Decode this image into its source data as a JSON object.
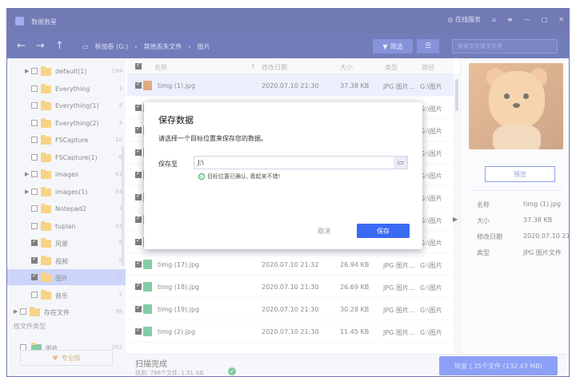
{
  "app": {
    "title": "数据救星"
  },
  "titlebar": {
    "online_service": "在线服务"
  },
  "breadcrumbs": [
    "新加卷 (G:)",
    "其他丢失文件",
    "图片"
  ],
  "toolbar": {
    "filter_label": "筛选",
    "search_placeholder": "搜索文件或文件夹"
  },
  "sidebar": {
    "items": [
      {
        "label": "default(1)",
        "count": "194",
        "checked": false,
        "arrow": true
      },
      {
        "label": "Everything",
        "count": "3",
        "checked": false,
        "arrow": false
      },
      {
        "label": "Everything(1)",
        "count": "4",
        "checked": false,
        "arrow": false
      },
      {
        "label": "Everything(2)",
        "count": "4",
        "checked": false,
        "arrow": false
      },
      {
        "label": "FSCapture",
        "count": "10",
        "checked": false,
        "arrow": false
      },
      {
        "label": "FSCapture(1)",
        "count": "6",
        "checked": false,
        "arrow": false
      },
      {
        "label": "images",
        "count": "63",
        "checked": false,
        "arrow": true
      },
      {
        "label": "images(1)",
        "count": "64",
        "checked": false,
        "arrow": true
      },
      {
        "label": "Notepad2",
        "count": "2",
        "checked": false,
        "arrow": false
      },
      {
        "label": "tuplan",
        "count": "43",
        "checked": false,
        "arrow": false
      },
      {
        "label": "风景",
        "count": "8",
        "checked": true,
        "arrow": false
      },
      {
        "label": "视频",
        "count": "5",
        "checked": true,
        "arrow": false
      },
      {
        "label": "图片",
        "count": "22",
        "checked": true,
        "arrow": false,
        "selected": true
      },
      {
        "label": "音乐",
        "count": "2",
        "checked": false,
        "arrow": false
      },
      {
        "label": "存在文件",
        "count": "98",
        "checked": false,
        "arrow": true
      }
    ],
    "section_title": "按文件类型",
    "type_item": {
      "label": "图片",
      "count": "262"
    },
    "pro_label": "专业版"
  },
  "table": {
    "headers": {
      "name": "名称",
      "modified": "修改日期",
      "size": "大小",
      "type": "类型",
      "path": "路径"
    },
    "rows": [
      {
        "name": "timg (1).jpg",
        "date": "2020.07.10 21:30",
        "size": "37.38 KB",
        "type": "JPG 图片...",
        "path": "G:\\图片"
      },
      {
        "name": "",
        "date": "",
        "size": "",
        "type": "",
        "path": "G:\\图片"
      },
      {
        "name": "",
        "date": "",
        "size": "",
        "type": "",
        "path": "G:\\图片"
      },
      {
        "name": "",
        "date": "",
        "size": "",
        "type": "",
        "path": "G:\\图片"
      },
      {
        "name": "",
        "date": "",
        "size": "",
        "type": "",
        "path": "G:\\图片"
      },
      {
        "name": "",
        "date": "",
        "size": "",
        "type": "",
        "path": "G:\\图片"
      },
      {
        "name": "",
        "date": "",
        "size": "",
        "type": "",
        "path": "G:\\图片"
      },
      {
        "name": "",
        "date": "",
        "size": "",
        "type": "",
        "path": "G:\\图片"
      },
      {
        "name": "timg (17).jpg",
        "date": "2020.07.10 21:32",
        "size": "26.94 KB",
        "type": "JPG 图片...",
        "path": "G:\\图片"
      },
      {
        "name": "timg (18).jpg",
        "date": "2020.07.10 21:30",
        "size": "26.69 KB",
        "type": "JPG 图片...",
        "path": "G:\\图片"
      },
      {
        "name": "timg (19).jpg",
        "date": "2020.07.10 21:30",
        "size": "30.28 KB",
        "type": "JPG 图片...",
        "path": "G:\\图片"
      },
      {
        "name": "timg (2).jpg",
        "date": "2020.07.10 21:30",
        "size": "11.45 KB",
        "type": "JPG 图片...",
        "path": "G:\\图片"
      }
    ]
  },
  "preview": {
    "button": "预览",
    "fields": [
      {
        "k": "名称",
        "v": "timg (1).jpg"
      },
      {
        "k": "大小",
        "v": "37.38 KB"
      },
      {
        "k": "修改日期",
        "v": "2020.07.10 21:30"
      },
      {
        "k": "类型",
        "v": "JPG 图片文件"
      }
    ]
  },
  "bottom": {
    "status": "扫描完成",
    "found": "找到: 796个文件, 1.51 GB",
    "recover": "恢复 | 35个文件 (132.43 MB)"
  },
  "dialog": {
    "title": "保存数据",
    "message": "请选择一个目标位置来保存您的数据。",
    "save_to_label": "保存至",
    "path_value": "J:\\",
    "ok_message": "目标位置已确认, 看起来不错!",
    "cancel": "取消",
    "save": "保存"
  }
}
